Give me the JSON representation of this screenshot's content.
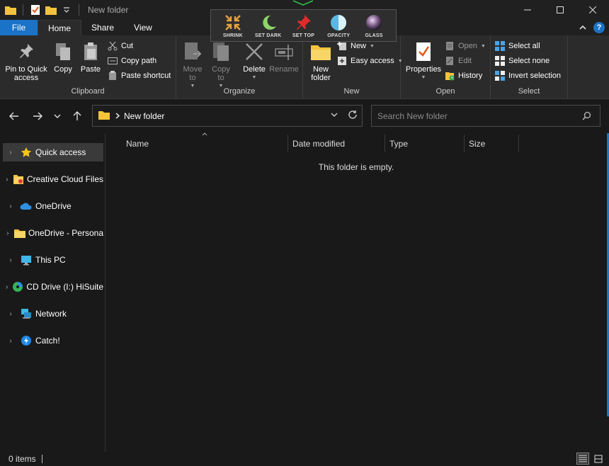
{
  "window": {
    "title": "New folder"
  },
  "overlay_toolbar": {
    "buttons": [
      {
        "label": "SHRINK",
        "icon": "shrink-icon"
      },
      {
        "label": "SET DARK",
        "icon": "moon-icon"
      },
      {
        "label": "SET TOP",
        "icon": "pin-icon"
      },
      {
        "label": "OPACITY",
        "icon": "opacity-icon"
      },
      {
        "label": "GLASS",
        "icon": "glass-icon"
      }
    ]
  },
  "ribbon_tabs": {
    "file": "File",
    "home": "Home",
    "share": "Share",
    "view": "View"
  },
  "ribbon": {
    "clipboard": {
      "label": "Clipboard",
      "pin_line1": "Pin to Quick",
      "pin_line2": "access",
      "copy": "Copy",
      "paste": "Paste",
      "cut": "Cut",
      "copy_path": "Copy path",
      "paste_shortcut": "Paste shortcut"
    },
    "organize": {
      "label": "Organize",
      "move_line1": "Move",
      "move_line2": "to",
      "copy_line1": "Copy",
      "copy_line2": "to",
      "delete": "Delete",
      "rename": "Rename"
    },
    "new": {
      "label": "New",
      "new_folder_line1": "New",
      "new_folder_line2": "folder",
      "new_item": "New",
      "easy_access": "Easy access"
    },
    "open": {
      "label": "Open",
      "properties": "Properties",
      "open": "Open",
      "edit": "Edit",
      "history": "History"
    },
    "select": {
      "label": "Select",
      "select_all": "Select all",
      "select_none": "Select none",
      "invert_selection": "Invert selection"
    }
  },
  "address_bar": {
    "path": "New folder",
    "search_placeholder": "Search New folder"
  },
  "nav_pane": {
    "items": [
      {
        "label": "Quick access",
        "icon": "star-icon",
        "selected": true
      },
      {
        "label": "Creative Cloud Files",
        "icon": "creative-cloud-folder-icon"
      },
      {
        "label": "OneDrive",
        "icon": "onedrive-cloud-icon"
      },
      {
        "label": "OneDrive - Persona",
        "icon": "folder-icon"
      },
      {
        "label": "This PC",
        "icon": "monitor-icon"
      },
      {
        "label": "CD Drive (I:) HiSuite",
        "icon": "cd-drive-icon"
      },
      {
        "label": "Network",
        "icon": "network-icon"
      },
      {
        "label": "Catch!",
        "icon": "catch-icon"
      }
    ]
  },
  "file_list": {
    "columns": [
      "Name",
      "Date modified",
      "Type",
      "Size"
    ],
    "empty_message": "This folder is empty."
  },
  "status_bar": {
    "items_count": "0 items"
  },
  "colors": {
    "accent": "#1a73c6",
    "background": "#191919",
    "ribbon": "#2b2b2b",
    "folder_yellow": "#f2c43d"
  }
}
